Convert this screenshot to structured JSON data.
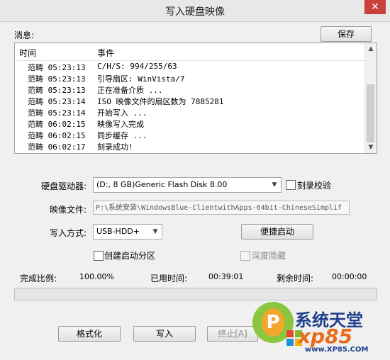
{
  "window": {
    "title": "写入硬盘映像",
    "close": "✕"
  },
  "messages": {
    "label": "消息:",
    "save_label": "保存",
    "col_time": "时间",
    "col_event": "事件",
    "rows": [
      {
        "time": "范畴 05:23:13",
        "event": "C/H/S: 994/255/63"
      },
      {
        "time": "范畴 05:23:13",
        "event": "引导扇区: WinVista/7"
      },
      {
        "time": "范畴 05:23:13",
        "event": "正在准备介质 ..."
      },
      {
        "time": "范畴 05:23:14",
        "event": "ISO 映像文件的扇区数为 7885281"
      },
      {
        "time": "范畴 05:23:14",
        "event": "开始写入 ..."
      },
      {
        "time": "范畴 06:02:15",
        "event": "映像写入完成"
      },
      {
        "time": "范畴 06:02:15",
        "event": "同步缓存 ..."
      },
      {
        "time": "范畴 06:02:17",
        "event": "刻录成功!"
      }
    ]
  },
  "form": {
    "drive_label": "硬盘驱动器:",
    "drive_value": "(D:, 8 GB)Generic Flash Disk       8.00",
    "verify_label": "刻录校验",
    "image_label": "映像文件:",
    "image_value": "P:\\系统安装\\WindowsBlue-ClientwithApps-64bit-ChineseSimplif",
    "method_label": "写入方式:",
    "method_value": "USB-HDD+",
    "quick_boot_label": "便捷启动",
    "create_partition_label": "创建启动分区",
    "hidden_label": "深度隐藏"
  },
  "status": {
    "percent_label": "完成比例:",
    "percent_value": "100.00%",
    "elapsed_label": "已用时间:",
    "elapsed_value": "00:39:01",
    "remaining_label": "剩余时间:",
    "remaining_value": "00:00:00",
    "progress_fraction": 1.0
  },
  "buttons": {
    "format": "格式化",
    "write": "写入",
    "stop": "终止[A]"
  },
  "watermark": {
    "brand": "系统天堂",
    "xp": "xp85",
    "url": "www.XP85.COM"
  },
  "colors": {
    "close": "#c8413b",
    "brand_blue": "#1e3f8c",
    "brand_orange": "#ea6a1a",
    "brand_green": "#8cc63f"
  }
}
